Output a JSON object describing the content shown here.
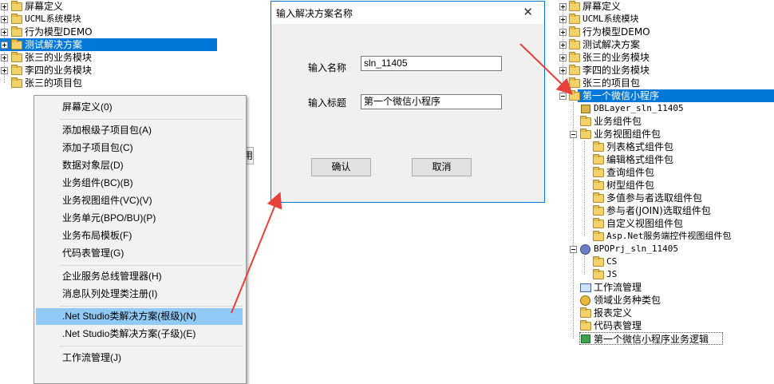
{
  "left_tree": {
    "items": [
      {
        "label": "屏幕定义",
        "selected": false
      },
      {
        "label": "UCML系统模块",
        "selected": false
      },
      {
        "label": "行为模型DEMO",
        "selected": false
      },
      {
        "label": "测试解决方案",
        "selected": true
      },
      {
        "label": "张三的业务模块",
        "selected": false
      },
      {
        "label": "李四的业务模块",
        "selected": false
      },
      {
        "label": "张三的项目包",
        "selected": false
      }
    ],
    "partial_button_text": "用"
  },
  "context_menu": {
    "items": [
      {
        "label": "屏幕定义(0)"
      },
      {
        "label": "添加根级子项目包(A)"
      },
      {
        "label": "添加子项目包(C)"
      },
      {
        "label": "数据对象层(D)"
      },
      {
        "label": "业务组件(BC)(B)"
      },
      {
        "label": "业务视图组件(VC)(V)"
      },
      {
        "label": "业务单元(BPO/BU)(P)"
      },
      {
        "label": "业务布局模板(F)"
      },
      {
        "label": "代码表管理(G)"
      },
      {
        "label": "企业服务总线管理器(H)"
      },
      {
        "label": "消息队列处理类注册(I)"
      },
      {
        "label": ".Net Studio类解决方案(根级)(N)",
        "highlighted": true
      },
      {
        "label": ".Net Studio类解决方案(子级)(E)"
      },
      {
        "label": "工作流管理(J)"
      }
    ]
  },
  "dialog": {
    "title": "输入解决方案名称",
    "close_glyph": "✕",
    "name_label": "输入名称",
    "name_value": "sln_11405",
    "title_label": "输入标题",
    "title_value": "第一个微信小程序",
    "ok_label": "确认",
    "cancel_label": "取消"
  },
  "right_tree": {
    "items": [
      {
        "label": "屏幕定义"
      },
      {
        "label": "UCML系统模块"
      },
      {
        "label": "行为模型DEMO"
      },
      {
        "label": "测试解决方案"
      },
      {
        "label": "张三的业务模块"
      },
      {
        "label": "李四的业务模块"
      },
      {
        "label": "张三的项目包"
      },
      {
        "label": "第一个微信小程序",
        "selected": true
      },
      {
        "label": "DBLayer_sln_11405"
      },
      {
        "label": "业务组件包"
      },
      {
        "label": "业务视图组件包"
      },
      {
        "label": "列表格式组件包"
      },
      {
        "label": "编辑格式组件包"
      },
      {
        "label": "查询组件包"
      },
      {
        "label": "树型组件包"
      },
      {
        "label": "多值参与者选取组件包"
      },
      {
        "label": "参与者(JOIN)选取组件包"
      },
      {
        "label": "自定义视图组件包"
      },
      {
        "label": "Asp.Net服务端控件视图组件包"
      },
      {
        "label": "BPOPrj_sln_11405"
      },
      {
        "label": "CS"
      },
      {
        "label": "JS"
      },
      {
        "label": "工作流管理"
      },
      {
        "label": "领域业务种类包"
      },
      {
        "label": "报表定义"
      },
      {
        "label": "代码表管理"
      },
      {
        "label": "第一个微信小程序业务逻辑"
      }
    ]
  },
  "colors": {
    "accent": "#0078d7",
    "menu_highlight": "#91c9f7",
    "arrow": "#e8403a"
  }
}
